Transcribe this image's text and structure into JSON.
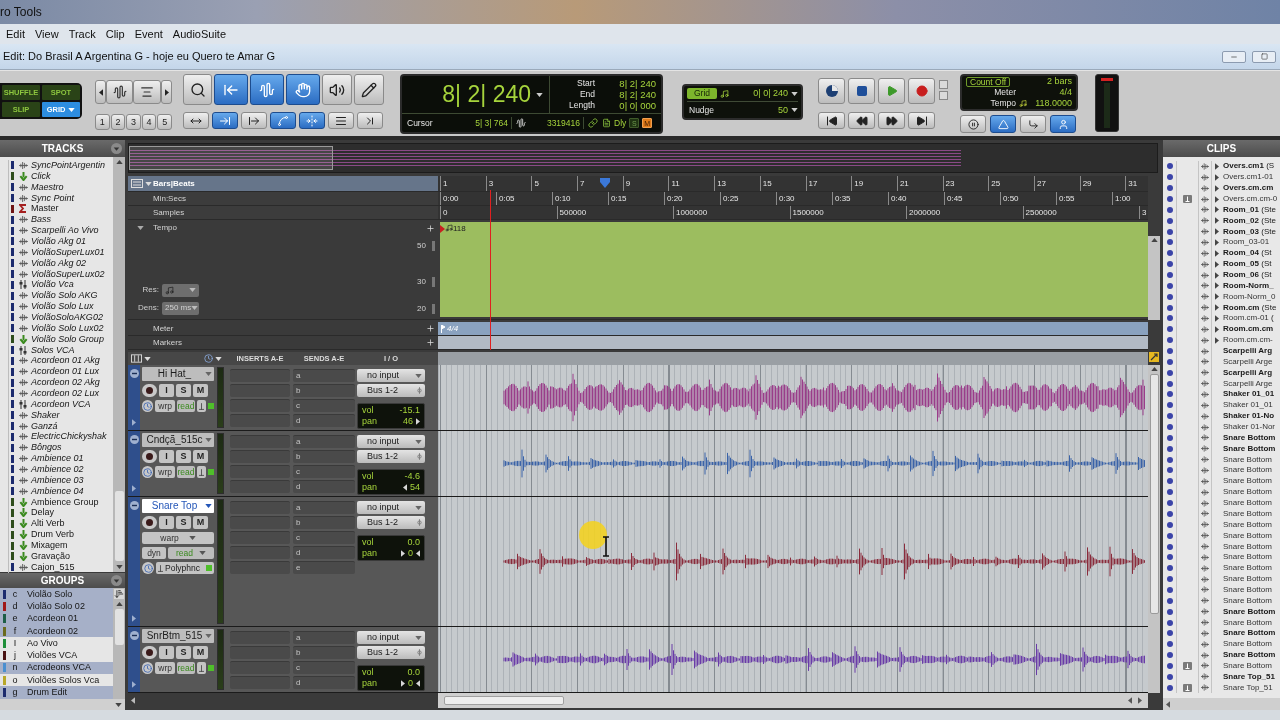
{
  "app": {
    "title": "ro Tools"
  },
  "menu": [
    "Edit",
    "View",
    "Track",
    "Clip",
    "Event",
    "AudioSuite"
  ],
  "edit_window": {
    "title": "Edit: Do Brasil A Argentina G - hoje eu Quero te Amar G"
  },
  "toolbar": {
    "edit_modes": [
      {
        "label": "SHUFFLE",
        "selected": false
      },
      {
        "label": "SPOT",
        "selected": false
      },
      {
        "label": "SLIP",
        "selected": false
      },
      {
        "label": "GRID",
        "selected": true
      }
    ],
    "zoom_buttons": [
      {
        "kind": "left"
      },
      {
        "kind": "audio"
      },
      {
        "kind": "midi"
      },
      {
        "kind": "right"
      }
    ],
    "zoom_presets": [
      "1",
      "2",
      "3",
      "4",
      "5"
    ],
    "tools": [
      {
        "kind": "zoom",
        "selected": false
      },
      {
        "kind": "trim",
        "selected": true
      },
      {
        "kind": "selector",
        "selected": true
      },
      {
        "kind": "grabber",
        "selected": true
      },
      {
        "kind": "scrub",
        "selected": false
      },
      {
        "kind": "pencil",
        "selected": false
      }
    ],
    "edit_options": [
      {
        "kind": "zoom-toggle",
        "on": false
      },
      {
        "kind": "tab-transients",
        "on": true
      },
      {
        "kind": "mirror-midi",
        "on": false
      },
      {
        "kind": "auto-fade",
        "on": true
      },
      {
        "kind": "link-timeline",
        "on": true
      },
      {
        "kind": "link-track",
        "on": false
      },
      {
        "kind": "insertion-follows",
        "on": false
      }
    ]
  },
  "counter": {
    "main": "8| 2| 240",
    "rows": [
      {
        "label": "Start",
        "value": "8| 2| 240"
      },
      {
        "label": "End",
        "value": "8| 2| 240"
      },
      {
        "label": "Length",
        "value": "0| 0| 000"
      }
    ],
    "cursor_label": "Cursor",
    "cursor_value": "5| 3| 764",
    "sample_value": "3319416",
    "delay": "Dly",
    "toggles": [
      {
        "label": "S",
        "on": false
      },
      {
        "label": "M",
        "on": true
      }
    ]
  },
  "grid": {
    "grid_label": "Grid",
    "grid_on": true,
    "grid_value": "0| 0| 240",
    "nudge_label": "Nudge",
    "nudge_value": "50"
  },
  "transport": {
    "top": [
      {
        "kind": "online"
      },
      {
        "kind": "stop"
      },
      {
        "kind": "play"
      },
      {
        "kind": "record"
      }
    ],
    "bottom": [
      {
        "kind": "start"
      },
      {
        "kind": "rewind"
      },
      {
        "kind": "forward"
      },
      {
        "kind": "end"
      }
    ]
  },
  "midi": {
    "rows": [
      {
        "kind": "count",
        "label": "Count Off",
        "value": "2 bars"
      },
      {
        "kind": "plain",
        "label": "Meter",
        "value": "4/4"
      },
      {
        "kind": "tempo",
        "label": "Tempo",
        "value": "118.0000"
      }
    ],
    "buttons": [
      {
        "kind": "wait",
        "on": false
      },
      {
        "kind": "click",
        "on": true
      },
      {
        "kind": "merge",
        "on": false
      },
      {
        "kind": "conductor",
        "on": true
      }
    ]
  },
  "tracks_panel": {
    "title": "TRACKS",
    "items": [
      {
        "name": "SyncPointArgentin",
        "kind": "audio",
        "color": "#1c2b6e",
        "inactive": true
      },
      {
        "name": "Click",
        "kind": "aux",
        "color": "#2e4d1c",
        "inactive": true
      },
      {
        "name": "Maestro",
        "kind": "audio",
        "color": "#1c2b6e",
        "inactive": true
      },
      {
        "name": "Sync Point",
        "kind": "audio",
        "color": "#1c2b6e",
        "inactive": true
      },
      {
        "name": "Master",
        "kind": "master",
        "color": "#6e1414",
        "inactive": false
      },
      {
        "name": "Bass",
        "kind": "audio",
        "color": "#1c2b6e",
        "inactive": true
      },
      {
        "name": "Scarpelli Ao Vivo",
        "kind": "audio",
        "color": "#1c2b6e",
        "inactive": true
      },
      {
        "name": "Violão Akg 01",
        "kind": "audio",
        "color": "#1c2b6e",
        "inactive": true
      },
      {
        "name": "ViolãoSuperLux01",
        "kind": "audio",
        "color": "#1c2b6e",
        "inactive": true
      },
      {
        "name": "Violão Akg 02",
        "kind": "audio",
        "color": "#1c2b6e",
        "inactive": true
      },
      {
        "name": "ViolãoSuperLux02",
        "kind": "audio",
        "color": "#1c2b6e",
        "inactive": true
      },
      {
        "name": "Violão Vca",
        "kind": "vca",
        "color": "#1c2b6e",
        "inactive": true
      },
      {
        "name": "Violão Solo AKG",
        "kind": "audio",
        "color": "#1c2b6e",
        "inactive": true
      },
      {
        "name": "Violão Solo Lux",
        "kind": "audio",
        "color": "#1c2b6e",
        "inactive": true
      },
      {
        "name": "ViolãoSoloAKG02",
        "kind": "audio",
        "color": "#1c2b6e",
        "inactive": true
      },
      {
        "name": "Violão Solo Lux02",
        "kind": "audio",
        "color": "#1c2b6e",
        "inactive": true
      },
      {
        "name": "Violão Solo Group",
        "kind": "aux",
        "color": "#2e4d1c",
        "inactive": true
      },
      {
        "name": "Solos VCA",
        "kind": "vca",
        "color": "#1c2b6e",
        "inactive": true
      },
      {
        "name": "Acordeon 01 Akg",
        "kind": "audio",
        "color": "#1c2b6e",
        "inactive": true
      },
      {
        "name": "Acordeon 01 Lux",
        "kind": "audio",
        "color": "#1c2b6e",
        "inactive": true
      },
      {
        "name": "Acordeon 02 Akg",
        "kind": "audio",
        "color": "#1c2b6e",
        "inactive": true
      },
      {
        "name": "Acordeon 02 Lux",
        "kind": "audio",
        "color": "#1c2b6e",
        "inactive": true
      },
      {
        "name": "Acordeon VCA",
        "kind": "vca",
        "color": "#1c2b6e",
        "inactive": true
      },
      {
        "name": "Shaker",
        "kind": "audio",
        "color": "#1c2b6e",
        "inactive": true
      },
      {
        "name": "Ganzá",
        "kind": "audio",
        "color": "#1c2b6e",
        "inactive": true
      },
      {
        "name": "ElectricChickyshak",
        "kind": "audio",
        "color": "#1c2b6e",
        "inactive": true
      },
      {
        "name": "Bôngos",
        "kind": "audio",
        "color": "#1c2b6e",
        "inactive": true
      },
      {
        "name": "Ambience 01",
        "kind": "audio",
        "color": "#1c2b6e",
        "inactive": true
      },
      {
        "name": "Ambience 02",
        "kind": "audio",
        "color": "#1c2b6e",
        "inactive": true
      },
      {
        "name": "Ambience 03",
        "kind": "audio",
        "color": "#1c2b6e",
        "inactive": true
      },
      {
        "name": "Ambience 04",
        "kind": "audio",
        "color": "#1c2b6e",
        "inactive": true
      },
      {
        "name": "Ambience Group",
        "kind": "aux",
        "color": "#2e4d1c",
        "inactive": false
      },
      {
        "name": "Delay",
        "kind": "aux",
        "color": "#2e4d1c",
        "inactive": false
      },
      {
        "name": "Alti Verb",
        "kind": "aux",
        "color": "#2e4d1c",
        "inactive": false
      },
      {
        "name": "Drum Verb",
        "kind": "aux",
        "color": "#2e4d1c",
        "inactive": false
      },
      {
        "name": "Mixagem",
        "kind": "aux",
        "color": "#2e4d1c",
        "inactive": false
      },
      {
        "name": "Gravação",
        "kind": "aux",
        "color": "#2e4d1c",
        "inactive": false
      },
      {
        "name": "Cajon_515",
        "kind": "audio",
        "color": "#1c2b6e",
        "inactive": false
      }
    ]
  },
  "groups_panel": {
    "title": "GROUPS",
    "items": [
      {
        "letter": "c",
        "name": "Violão Solo",
        "color": "#1c2b6e",
        "selected": true
      },
      {
        "letter": "d",
        "name": "Violão Solo 02",
        "color": "#a01818",
        "selected": true
      },
      {
        "letter": "e",
        "name": "Acordeon 01",
        "color": "#1d5e46",
        "selected": true
      },
      {
        "letter": "f",
        "name": "Acordeon 02",
        "color": "#6b6b1e",
        "selected": true
      },
      {
        "letter": "I",
        "name": "Ao Vivo",
        "color": "#1f8f3a",
        "selected": false
      },
      {
        "letter": "j",
        "name": "Violões VCA",
        "color": "#4a1414",
        "selected": false
      },
      {
        "letter": "n",
        "name": "Acrodeons VCA",
        "color": "#4a8fd0",
        "selected": true
      },
      {
        "letter": "o",
        "name": "Violões Solos Vca",
        "color": "#b8a82a",
        "selected": false
      },
      {
        "letter": "g",
        "name": "Drum Edit",
        "color": "#1c2b6e",
        "selected": true
      }
    ]
  },
  "rulers": [
    {
      "kind": "bars",
      "label": "Bars|Beats",
      "selected": true,
      "ticks": [
        "1",
        "3",
        "5",
        "7",
        "9",
        "11",
        "13",
        "15",
        "17",
        "19",
        "21",
        "23",
        "25",
        "27",
        "29",
        "31"
      ]
    },
    {
      "kind": "minsecs",
      "label": "Min:Secs",
      "selected": false,
      "ticks": [
        "0:00",
        "0:05",
        "0:10",
        "0:15",
        "0:20",
        "0:25",
        "0:30",
        "0:35",
        "0:40",
        "0:45",
        "0:50",
        "0:55",
        "1:00"
      ]
    },
    {
      "kind": "samples",
      "label": "Samples",
      "selected": false,
      "ticks": [
        "0",
        "500000",
        "1000000",
        "1500000",
        "2000000",
        "2500000",
        "3"
      ]
    }
  ],
  "tempo": {
    "label": "Tempo",
    "scale": [
      "50",
      "30",
      "20"
    ],
    "res_label": "Res:",
    "dens_label": "Dens:",
    "dens_value": "250 ms",
    "marker": "118"
  },
  "meter_ruler": {
    "label": "Meter",
    "marker": "4/4"
  },
  "markers_ruler": {
    "label": "Markers"
  },
  "track_columns": [
    "INSERTS A-E",
    "SENDS A-E",
    "I / O"
  ],
  "tracks": [
    {
      "name": "Hi Hat_",
      "selected": false,
      "kind": "small",
      "buttons": [
        "I",
        "S",
        "M"
      ],
      "elastic": "wrp",
      "automation": "read",
      "sends": [
        "a",
        "b",
        "c",
        "d"
      ],
      "input": "no input",
      "output": "Bus 1-2",
      "vol_label": "vol",
      "vol": "-15.1",
      "pan": {
        "kind": "right",
        "label": "pan",
        "value": "46"
      },
      "color": "#9a3d8a"
    },
    {
      "name": "Cndçã_515c",
      "selected": false,
      "kind": "small",
      "buttons": [
        "I",
        "S",
        "M"
      ],
      "elastic": "wrp",
      "automation": "read",
      "sends": [
        "a",
        "b",
        "c",
        "d"
      ],
      "input": "no input",
      "output": "Bus 1-2",
      "vol_label": "vol",
      "vol": "-4.6",
      "pan": {
        "kind": "left",
        "label": "pan",
        "value": "54"
      },
      "color": "#3a63a8"
    },
    {
      "name": "Snare Top",
      "selected": true,
      "kind": "large",
      "buttons": [
        "I",
        "S",
        "M"
      ],
      "elastic": "warp",
      "dyn": "dyn",
      "automation": "read",
      "plugin": "Polyphnc",
      "sends": [
        "a",
        "b",
        "c",
        "d",
        "e"
      ],
      "input": "no input",
      "output": "Bus 1-2",
      "vol_label": "vol",
      "vol": "0.0",
      "pan": {
        "kind": "center",
        "label": "pan",
        "value": "0"
      },
      "color": "#8a2c3c"
    },
    {
      "name": "SnrBtm_515",
      "selected": false,
      "kind": "small",
      "buttons": [
        "I",
        "S",
        "M"
      ],
      "elastic": "wrp",
      "automation": "read",
      "sends": [
        "a",
        "b",
        "c",
        "d"
      ],
      "input": "no input",
      "output": "Bus 1-2",
      "vol_label": "vol",
      "vol": "0.0",
      "pan": {
        "kind": "center",
        "label": "pan",
        "value": "0"
      },
      "color": "#6a3ca8"
    }
  ],
  "clips_panel": {
    "title": "CLIPS",
    "items": [
      {
        "name": "Overs.cm1",
        "suffix": "(S",
        "kind": "whole",
        "expandable": true,
        "badge": false
      },
      {
        "name": "Overs.cm1-01",
        "kind": "subset",
        "expandable": true,
        "badge": false
      },
      {
        "name": "Overs.cm.cm",
        "kind": "whole",
        "expandable": true,
        "badge": false
      },
      {
        "name": "Overs.cm.cm-0",
        "kind": "subset",
        "expandable": true,
        "badge": true
      },
      {
        "name": "Room_01",
        "suffix": "(Ste",
        "kind": "whole",
        "expandable": true,
        "badge": false
      },
      {
        "name": "Room_02",
        "suffix": "(Ste",
        "kind": "whole",
        "expandable": true,
        "badge": false
      },
      {
        "name": "Room_03",
        "suffix": "(Ste",
        "kind": "whole",
        "expandable": true,
        "badge": false
      },
      {
        "name": "Room_03-01",
        "kind": "subset",
        "expandable": true,
        "badge": false
      },
      {
        "name": "Room_04",
        "suffix": "(St",
        "kind": "whole",
        "expandable": true,
        "badge": false
      },
      {
        "name": "Room_05",
        "suffix": "(St",
        "kind": "whole",
        "expandable": true,
        "badge": false
      },
      {
        "name": "Room_06",
        "suffix": "(St",
        "kind": "whole",
        "expandable": true,
        "badge": false
      },
      {
        "name": "Room-Norm_",
        "kind": "whole",
        "expandable": true,
        "badge": false
      },
      {
        "name": "Room-Norm_0",
        "kind": "subset",
        "expandable": true,
        "badge": false
      },
      {
        "name": "Room.cm",
        "suffix": "(Ste",
        "kind": "whole",
        "expandable": true,
        "badge": false
      },
      {
        "name": "Room.cm-01",
        "suffix": "(",
        "kind": "subset",
        "expandable": true,
        "badge": false
      },
      {
        "name": "Room.cm.cm",
        "kind": "whole",
        "expandable": true,
        "badge": false
      },
      {
        "name": "Room.cm.cm-",
        "kind": "subset",
        "expandable": true,
        "badge": false
      },
      {
        "name": "Scarpelli Arg",
        "kind": "whole",
        "expandable": false,
        "badge": false
      },
      {
        "name": "Scarpelli Arge",
        "kind": "subset",
        "expandable": false,
        "badge": false
      },
      {
        "name": "Scarpelli Arg",
        "kind": "whole",
        "expandable": false,
        "badge": false
      },
      {
        "name": "Scarpelli Arge",
        "kind": "subset",
        "expandable": false,
        "badge": false
      },
      {
        "name": "Shaker 01_01",
        "kind": "whole",
        "expandable": false,
        "badge": false
      },
      {
        "name": "Shaker 01_01",
        "kind": "subset",
        "expandable": false,
        "badge": false
      },
      {
        "name": "Shaker 01-No",
        "kind": "whole",
        "expandable": false,
        "badge": false
      },
      {
        "name": "Shaker 01-Nor",
        "kind": "subset",
        "expandable": false,
        "badge": false
      },
      {
        "name": "Snare Bottom",
        "kind": "whole",
        "expandable": false,
        "badge": false
      },
      {
        "name": "Snare Bottom",
        "kind": "whole",
        "expandable": false,
        "badge": false
      },
      {
        "name": "Snare Bottom",
        "kind": "subset",
        "expandable": false,
        "badge": false
      },
      {
        "name": "Snare Bottom",
        "kind": "subset",
        "expandable": false,
        "badge": false
      },
      {
        "name": "Snare Bottom",
        "kind": "subset",
        "expandable": false,
        "badge": false
      },
      {
        "name": "Snare Bottom",
        "kind": "subset",
        "expandable": false,
        "badge": false
      },
      {
        "name": "Snare Bottom",
        "kind": "subset",
        "expandable": false,
        "badge": false
      },
      {
        "name": "Snare Bottom",
        "kind": "subset",
        "expandable": false,
        "badge": false
      },
      {
        "name": "Snare Bottom",
        "kind": "subset",
        "expandable": false,
        "badge": false
      },
      {
        "name": "Snare Bottom",
        "kind": "subset",
        "expandable": false,
        "badge": false
      },
      {
        "name": "Snare Bottom",
        "kind": "subset",
        "expandable": false,
        "badge": false
      },
      {
        "name": "Snare Bottom",
        "kind": "subset",
        "expandable": false,
        "badge": false
      },
      {
        "name": "Snare Bottom",
        "kind": "subset",
        "expandable": false,
        "badge": false
      },
      {
        "name": "Snare Bottom",
        "kind": "subset",
        "expandable": false,
        "badge": false
      },
      {
        "name": "Snare Bottom",
        "kind": "subset",
        "expandable": false,
        "badge": false
      },
      {
        "name": "Snare Bottom",
        "kind": "subset",
        "expandable": false,
        "badge": false
      },
      {
        "name": "Snare Bottom",
        "kind": "whole",
        "expandable": false,
        "badge": false
      },
      {
        "name": "Snare Bottom",
        "kind": "subset",
        "expandable": false,
        "badge": false
      },
      {
        "name": "Snare Bottom",
        "kind": "whole",
        "expandable": false,
        "badge": false
      },
      {
        "name": "Snare Bottom",
        "kind": "subset",
        "expandable": false,
        "badge": false
      },
      {
        "name": "Snare Bottom",
        "kind": "whole",
        "expandable": false,
        "badge": false
      },
      {
        "name": "Snare Bottom",
        "kind": "subset",
        "expandable": false,
        "badge": true
      },
      {
        "name": "Snare Top_51",
        "kind": "whole",
        "expandable": false,
        "badge": false
      },
      {
        "name": "Snare Top_51",
        "kind": "subset",
        "expandable": false,
        "badge": true
      }
    ]
  }
}
